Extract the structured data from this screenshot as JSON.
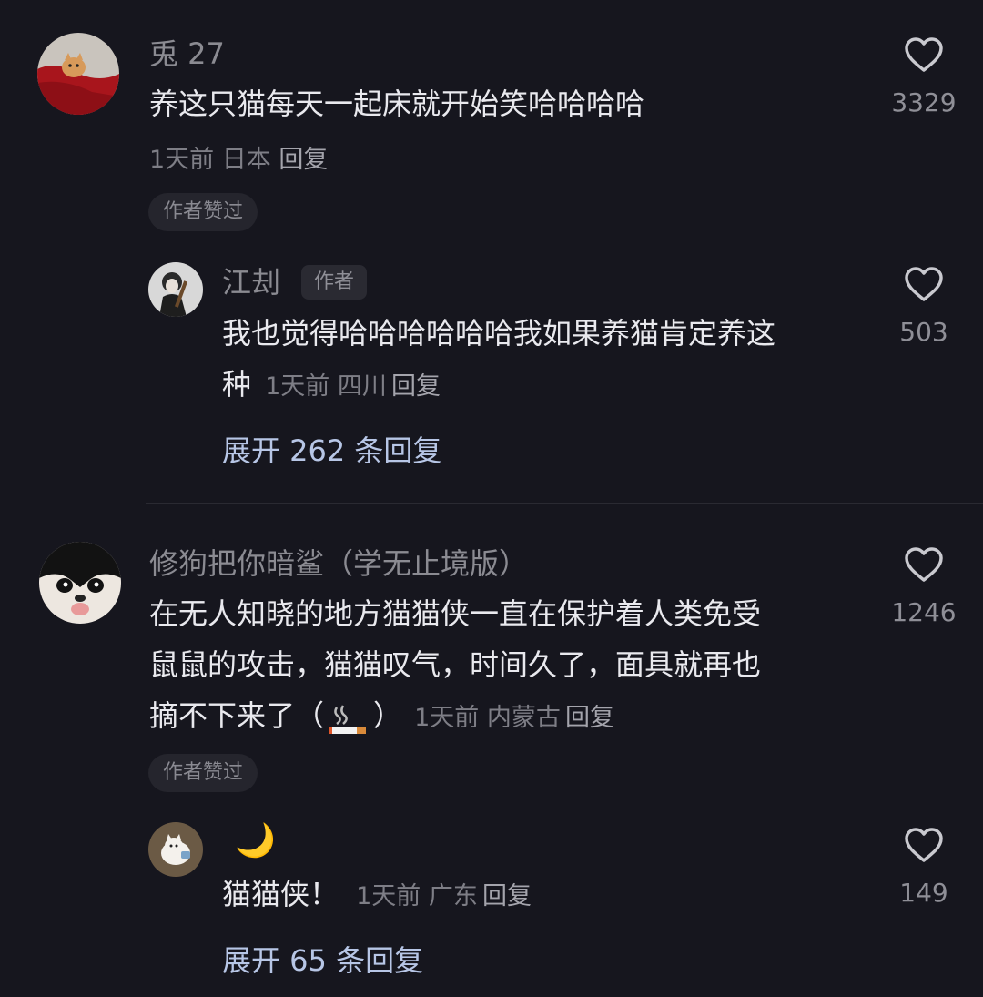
{
  "comments": [
    {
      "username": "兎 27",
      "text": "养这只猫每天一起床就开始笑哈哈哈哈",
      "meta": "1天前 日本",
      "reply_label": "回复",
      "badge": "作者赞过",
      "likes": "3329",
      "replies": [
        {
          "username": "江刦",
          "author_tag": "作者",
          "text_line1": "我也觉得哈哈哈哈哈哈我如果养猫肯定养这",
          "text_line2": "种",
          "meta": "1天前 四川",
          "reply_label": "回复",
          "likes": "503"
        }
      ],
      "expand_label": "展开 262 条回复"
    },
    {
      "username": "修狗把你暗鲨（学无止境版）",
      "text_line1": "在无人知晓的地方猫猫侠一直在保护着人类免受",
      "text_line2": "鼠鼠的攻击，猫猫叹气，时间久了，面具就再也",
      "text_line3": "摘不下来了（",
      "text_line3_end": "）",
      "meta": "1天前 内蒙古",
      "reply_label": "回复",
      "badge": "作者赞过",
      "likes": "1246",
      "replies": [
        {
          "username": "🌙",
          "text": "猫猫侠！",
          "meta": "1天前 广东",
          "reply_label": "回复",
          "likes": "149"
        }
      ],
      "expand_label": "展开 65 条回复"
    }
  ],
  "icons": {
    "like": "heart-outline-icon",
    "smoke": "cigarette-emoji-icon"
  },
  "colors": {
    "background": "#16161e",
    "username": "#8b8b92",
    "content": "#e9e9ee",
    "meta": "#7e7e86",
    "expand": "#b7c6e6"
  }
}
